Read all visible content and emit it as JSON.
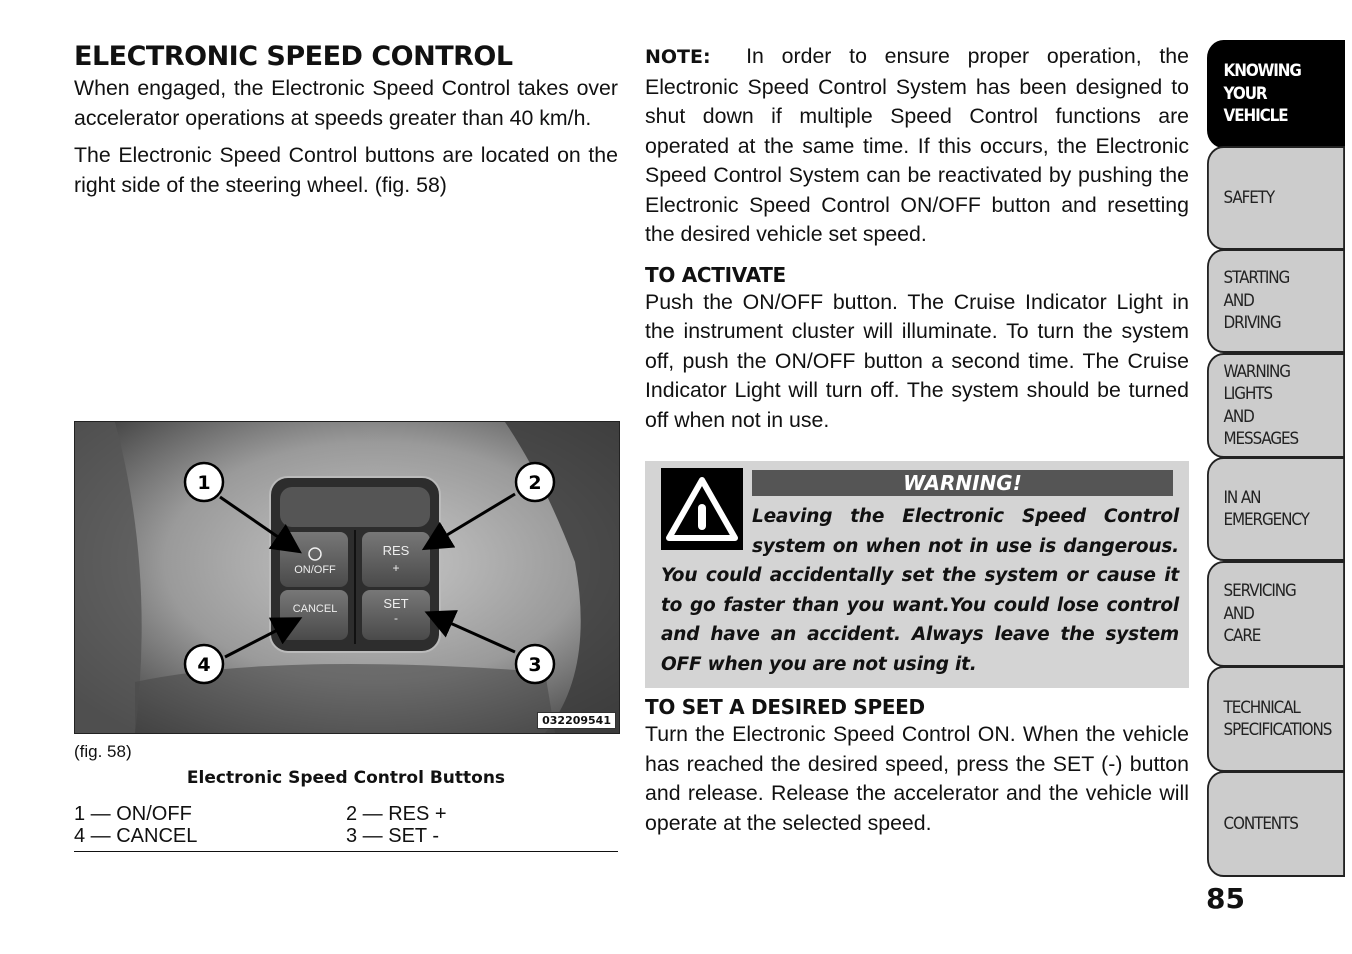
{
  "left": {
    "title": "ELECTRONIC SPEED CONTROL",
    "para1": "When engaged, the Electronic Speed Control takes over accelerator operations at speeds greater than 40 km/h.",
    "para2": "The Electronic Speed Control buttons are located on the right side of the steering wheel.  (fig.  58)",
    "figure": {
      "id": "032209541",
      "ref": "(fig. 58)",
      "caption": "Electronic Speed Control Buttons",
      "callouts": [
        "1",
        "2",
        "3",
        "4"
      ],
      "button_labels": {
        "on_off": "ON/OFF",
        "res": "RES",
        "res_sign": "+",
        "cancel": "CANCEL",
        "set": "SET",
        "set_sign": "-"
      },
      "legend": [
        [
          "1 — ON/OFF",
          "2 — RES +"
        ],
        [
          "4 — CANCEL",
          "3 — SET -"
        ]
      ]
    }
  },
  "right": {
    "note_label": "NOTE:",
    "note_text": "In order to ensure proper operation, the Electronic Speed Control System has been designed to shut down if multiple Speed Control functions are operated at the same time. If this occurs, the Electronic Speed Control System can be reactivated by pushing the Electronic Speed Control ON/OFF button and resetting the desired vehicle set speed.",
    "activate_heading": "TO ACTIVATE",
    "activate_text": "Push the ON/OFF button. The Cruise Indicator Light in the instrument cluster will illuminate. To turn the system off, push the ON/OFF button a second time. The Cruise Indicator Light will turn off. The system should be turned off when not in use.",
    "warning": {
      "heading": "WARNING!",
      "icon": "warning-triangle-icon",
      "text": "Leaving the Electronic Speed Control system on when not in use is dangerous. You could accidentally set the system or cause it to go faster than you want.You could lose control and have an accident. Always leave the system OFF when you are not using it."
    },
    "set_heading": "TO SET A DESIRED SPEED",
    "set_text": "Turn the Electronic Speed Control ON. When the vehicle has reached the desired speed, press the SET (-) button and release. Release the accelerator and the vehicle will operate at the selected speed."
  },
  "tabs": [
    {
      "label": "KNOWING\nYOUR\nVEHICLE",
      "active": true
    },
    {
      "label": "SAFETY",
      "active": false
    },
    {
      "label": "STARTING\nAND\nDRIVING",
      "active": false
    },
    {
      "label": "WARNING\nLIGHTS\nAND\nMESSAGES",
      "active": false
    },
    {
      "label": "IN AN\nEMERGENCY",
      "active": false
    },
    {
      "label": "SERVICING\nAND\nCARE",
      "active": false
    },
    {
      "label": "TECHNICAL\nSPECIFICATIONS",
      "active": false
    },
    {
      "label": "CONTENTS",
      "active": false
    }
  ],
  "page_number": "85"
}
